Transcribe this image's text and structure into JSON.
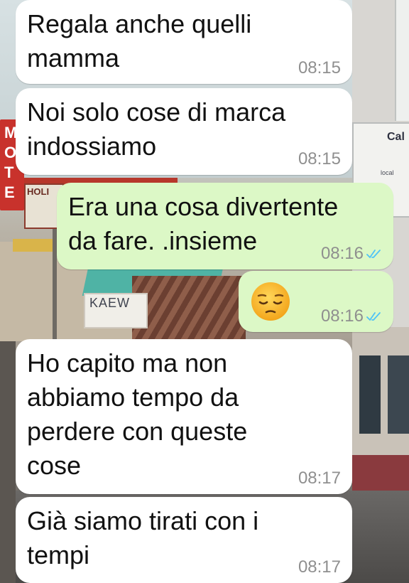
{
  "chat": {
    "messages": [
      {
        "direction": "incoming",
        "text": "Regala anche quelli\nmamma",
        "time": "08:15"
      },
      {
        "direction": "incoming",
        "text": "Noi solo cose di marca\nindossiamo",
        "time": "08:15"
      },
      {
        "direction": "outgoing",
        "text": "Era una cosa divertente\nda fare. .insieme",
        "time": "08:16",
        "status": "read"
      },
      {
        "direction": "outgoing",
        "emoji": "pensive-face",
        "time": "08:16",
        "status": "read"
      },
      {
        "direction": "incoming",
        "text": "Ho capito ma non\nabbiamo tempo da\nperdere con queste\ncose",
        "time": "08:17"
      },
      {
        "direction": "incoming",
        "text": "Già siamo tirati con i\ntempi",
        "time": "08:17"
      }
    ]
  },
  "wallpaper": {
    "sign_left": "MOTE",
    "sign_holiday": "HOLI",
    "sign_kaew": "KAEW",
    "sign_right": "Cal"
  },
  "colors": {
    "incoming_bubble": "#ffffff",
    "outgoing_bubble": "#dcf8c6",
    "timestamp": "#8f8f8f",
    "read_ticks": "#4fc3f7"
  }
}
